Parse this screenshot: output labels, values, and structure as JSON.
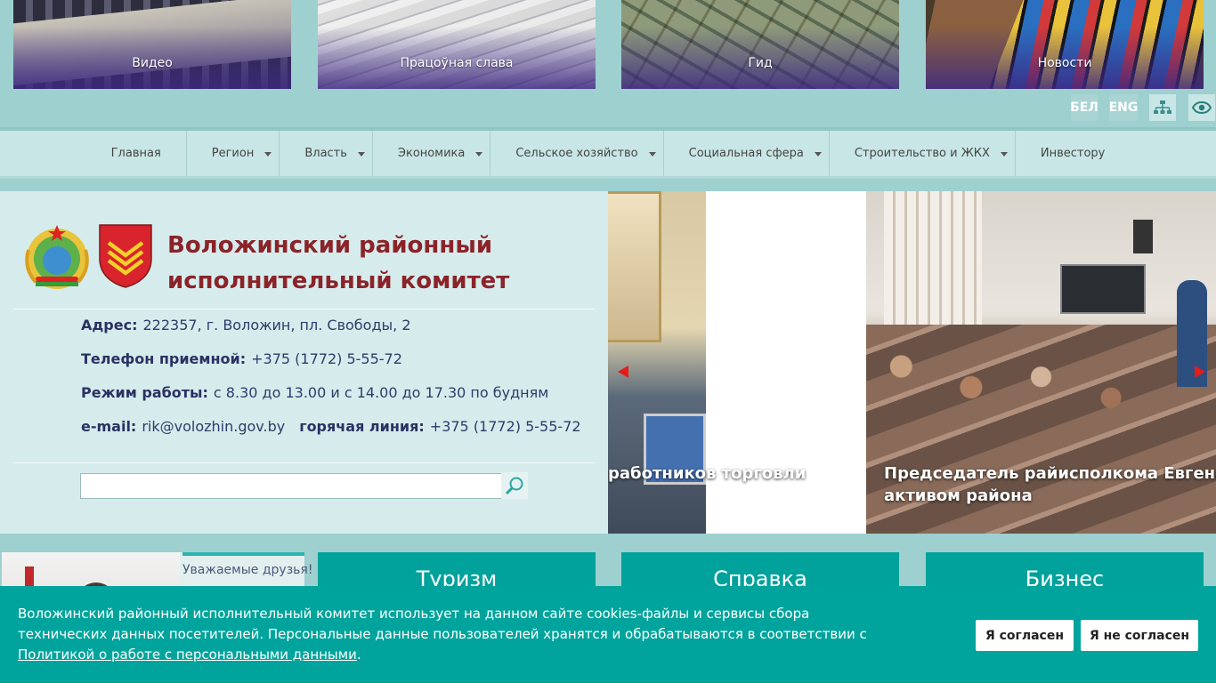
{
  "tiles": [
    {
      "label": "Видео"
    },
    {
      "label": "Працоўная слава"
    },
    {
      "label": "Гид"
    },
    {
      "label": "Новости"
    }
  ],
  "lang": {
    "bel": "БЕЛ",
    "eng": "ENG"
  },
  "icons": {
    "sitemap": "sitemap-icon",
    "eye": "eye-icon",
    "search": "search-icon"
  },
  "nav": [
    {
      "label": "Главная",
      "dropdown": false
    },
    {
      "label": "Регион",
      "dropdown": true
    },
    {
      "label": "Власть",
      "dropdown": true
    },
    {
      "label": "Экономика",
      "dropdown": true
    },
    {
      "label": "Сельское хозяйство",
      "dropdown": true
    },
    {
      "label": "Социальная сфера",
      "dropdown": true
    },
    {
      "label": "Строительство и ЖКХ",
      "dropdown": true
    },
    {
      "label": "Инвестору",
      "dropdown": false
    }
  ],
  "org": {
    "title_line1": "Воложинский районный",
    "title_line2": "исполнительный комитет"
  },
  "contacts": {
    "address_label": "Адрес:",
    "address": "222357, г. Воложин, пл. Свободы, 2",
    "phone_label": "Телефон приемной:",
    "phone": "+375 (1772) 5-55-72",
    "hours_label": "Режим работы:",
    "hours": "с 8.30 до 13.00 и с 14.00 до 17.30 по будням",
    "email_label": "e-mail:",
    "email": "rik@volozhin.gov.by",
    "hotline_label": "горячая линия:",
    "hotline": "+375 (1772) 5-55-72"
  },
  "search": {
    "placeholder": "",
    "value": ""
  },
  "slider": {
    "caption1": "работников торговли",
    "caption2_line1": "Председатель райисполкома Евгений К",
    "caption2_line2": "активом района"
  },
  "news": {
    "text": "Уважаемые друзья!"
  },
  "categories": [
    {
      "label": "Туризм"
    },
    {
      "label": "Справка"
    },
    {
      "label": "Бизнес"
    }
  ],
  "cookie": {
    "text": "Воложинский районный исполнительный комитет использует на данном сайте cookies-файлы и сервисы сбора технических данных посетителей. Персональные данные пользователей хранятся и обрабатываются в соответствии с ",
    "link": "Политикой о работе с персональными данными",
    "tail": ".",
    "agree": "Я согласен",
    "decline": "Я не согласен"
  },
  "colors": {
    "accent": "#00a49c",
    "title": "#8b2329",
    "nav_bg": "#c8e6e5",
    "arrow": "#e51c1c"
  }
}
